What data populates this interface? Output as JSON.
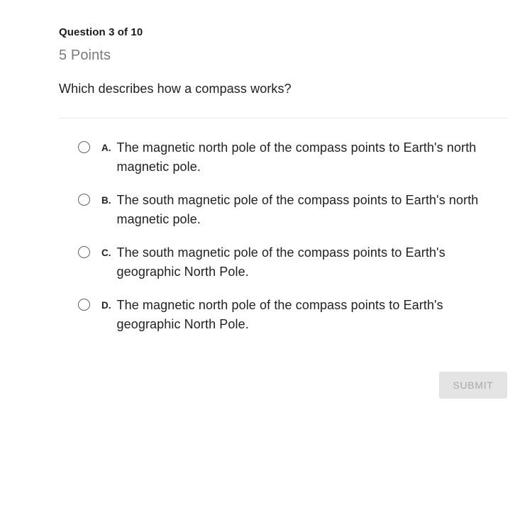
{
  "header": {
    "question_counter": "Question 3 of 10",
    "points": "5 Points"
  },
  "question": {
    "prompt": "Which describes how a compass works?"
  },
  "options": [
    {
      "letter": "A.",
      "text": "The magnetic north pole of the compass points to Earth's north magnetic pole.",
      "selected": false
    },
    {
      "letter": "B.",
      "text": "The south magnetic pole of the compass points to Earth's north magnetic pole.",
      "selected": false
    },
    {
      "letter": "C.",
      "text": "The south magnetic pole of the compass points to Earth's geographic North Pole.",
      "selected": false
    },
    {
      "letter": "D.",
      "text": "The magnetic north pole of the compass points to Earth's geographic North Pole.",
      "selected": false
    }
  ],
  "footer": {
    "submit_label": "SUBMIT",
    "submit_enabled": false
  },
  "colors": {
    "page_background": "#ffffff",
    "heading_text": "#1a1a1a",
    "body_text": "#202124",
    "muted_text": "#7a7a7a",
    "divider": "#e8e8e8",
    "radio_border": "#5f6368",
    "submit_background": "#e4e4e4",
    "submit_text": "#a8a8a8"
  }
}
